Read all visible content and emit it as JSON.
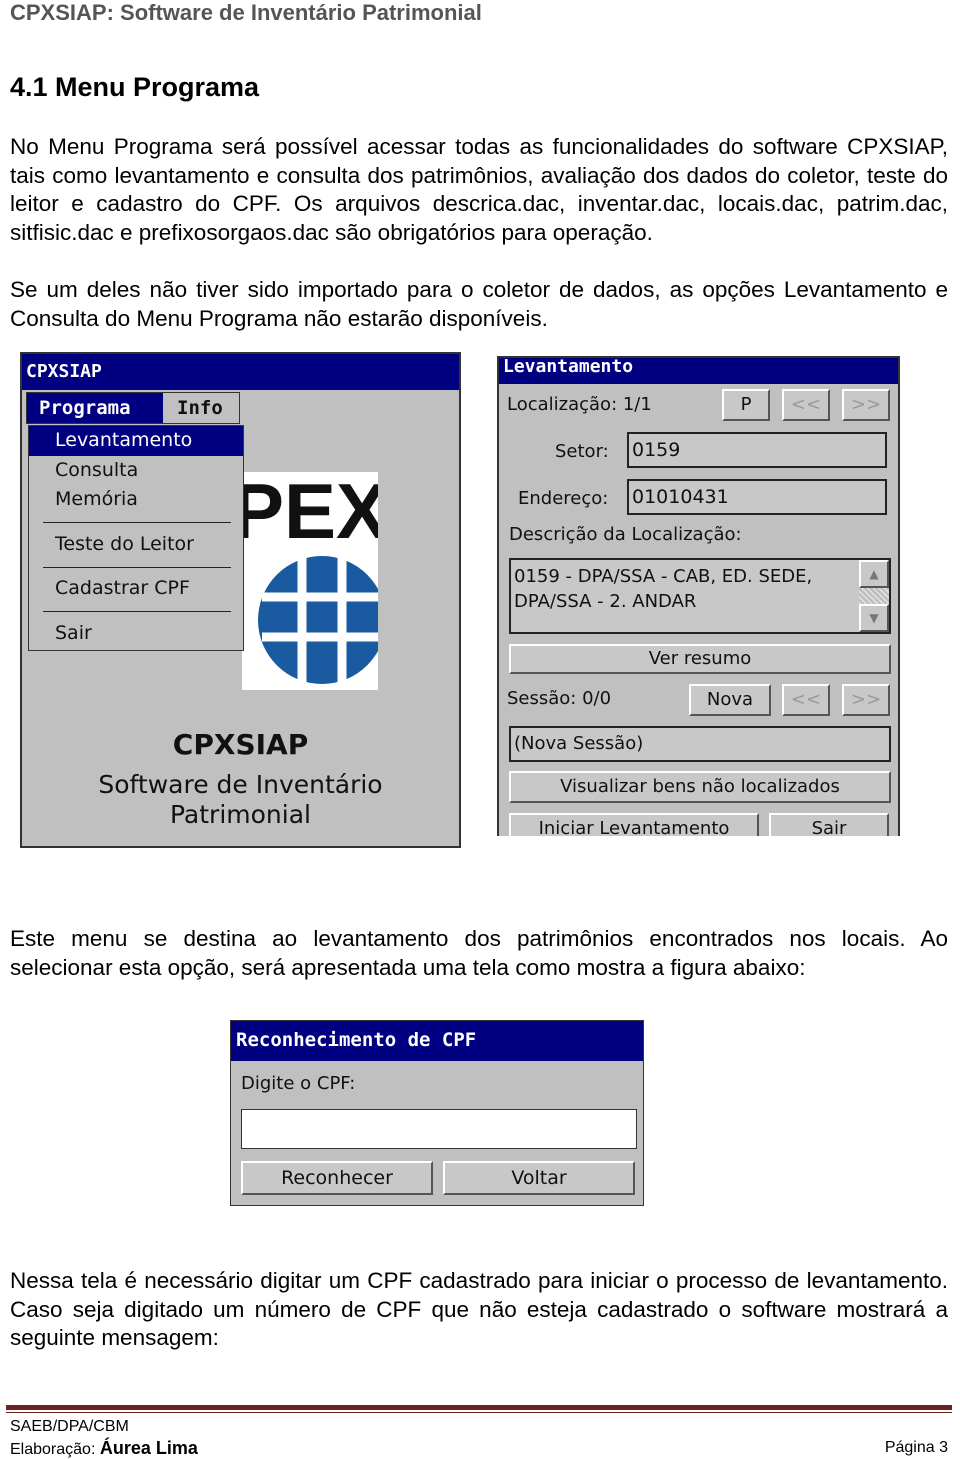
{
  "header": "CPXSIAP: Software de Inventário Patrimonial",
  "section_title": "4.1 Menu Programa",
  "paragraph1": "No Menu Programa será possível acessar todas as funcionalidades do software CPXSIAP, tais como levantamento e consulta dos patrimônios, avaliação dos dados do coletor, teste do leitor e cadastro do CPF. Os arquivos descrica.dac, inventar.dac, locais.dac, patrim.dac, sitfisic.dac e prefixosorgaos.dac são obrigatórios para operação.",
  "paragraph2": "Se um deles não tiver sido importado para o coletor de dados, as opções Levantamento e Consulta do Menu Programa não estarão disponíveis.",
  "main_window": {
    "title": "CPXSIAP",
    "menubar": [
      "Programa",
      "Info"
    ],
    "menu_items": [
      "Levantamento",
      "Consulta",
      "Memória",
      "Teste do Leitor",
      "Cadastrar CPF",
      "Sair"
    ],
    "logo_text": "PEX",
    "app_name": "CPXSIAP",
    "subtitle1": "Software de Inventário",
    "subtitle2": "Patrimonial"
  },
  "levantamento": {
    "title": "Levantamento",
    "localizacao_label": "Localização: 1/1",
    "p_btn": "P",
    "prev": "<<",
    "next": ">>",
    "setor_label": "Setor:",
    "setor_value": "0159",
    "endereco_label": "Endereço:",
    "endereco_value": "01010431",
    "descricao_label": "Descrição da Localização:",
    "descricao_line1": "0159 - DPA/SSA - CAB, ED. SEDE,",
    "descricao_line2": "DPA/SSA -  2. ANDAR",
    "ver_resumo": "Ver resumo",
    "sessao_label": "Sessão: 0/0",
    "nova": "Nova",
    "sessao_value": "(Nova Sessão)",
    "visualizar": "Visualizar bens não localizados",
    "iniciar": "Iniciar Levantamento",
    "sair": "Sair"
  },
  "paragraph3": "Este menu se destina ao levantamento dos patrimônios encontrados nos locais. Ao selecionar esta opção, será apresentada uma tela como mostra a figura abaixo:",
  "cpf_dialog": {
    "title": "Reconhecimento de CPF",
    "label": "Digite o CPF:",
    "value": "",
    "reconhecer": "Reconhecer",
    "voltar": "Voltar"
  },
  "paragraph4": "Nessa tela é necessário digitar um CPF cadastrado para iniciar o processo de levantamento. Caso seja digitado um número de CPF que não esteja cadastrado o software mostrará a seguinte mensagem:",
  "footer": {
    "org": "SAEB/DPA/CBM",
    "author_label": "Elaboração: ",
    "author": "Áurea Lima",
    "page": "Página 3"
  },
  "colors": {
    "titlebar": "#000080",
    "window": "#c0c0c0",
    "footer_rule": "#6b2222",
    "globe": "#1a5aa0"
  }
}
